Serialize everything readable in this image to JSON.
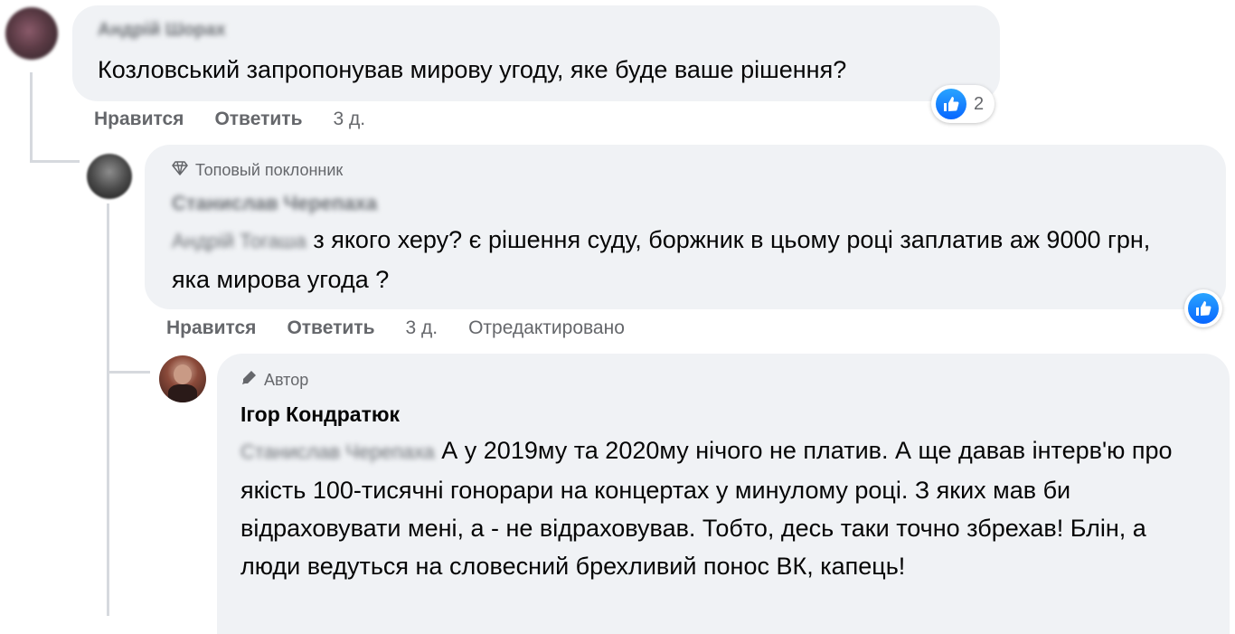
{
  "comments": [
    {
      "author": "Андрій Шорах",
      "text": "Козловський запропонував мирову угоду, яке буде ваше рішення?",
      "actions": {
        "like": "Нравится",
        "reply": "Ответить",
        "time": "3 д."
      },
      "reactions": {
        "type": "like-icon",
        "count": "2"
      }
    },
    {
      "badge": "Топовый поклонник",
      "badge_icon": "diamond-icon",
      "author": "Станислав Черепаха",
      "mention": "Андрій Тогаша",
      "text": " з якого херу? є рішення суду, боржник в цьому році заплатив аж 9000 грн, яка мирова угода ?",
      "actions": {
        "like": "Нравится",
        "reply": "Ответить",
        "time": "3 д.",
        "edited": "Отредактировано"
      },
      "reactions": {
        "type": "like-icon",
        "count": ""
      }
    },
    {
      "badge": "Автор",
      "badge_icon": "pen-icon",
      "author": "Ігор Кондратюк",
      "mention": "Станислав Черепаха",
      "text": " А у 2019му та 2020му нічого не платив. А ще давав інтерв'ю про якість 100-тисячні гонорари на концертах у минулому році. З яких мав би відраховувати мені, а - не відраховував. Тобто, десь таки точно збрехав! Блін, а люди ведуться на словесний брехливий понос ВК, капець!"
    }
  ],
  "colors": {
    "bubble": "#f0f2f5",
    "meta": "#65676b",
    "like": "#0866ff",
    "text": "#050505"
  }
}
